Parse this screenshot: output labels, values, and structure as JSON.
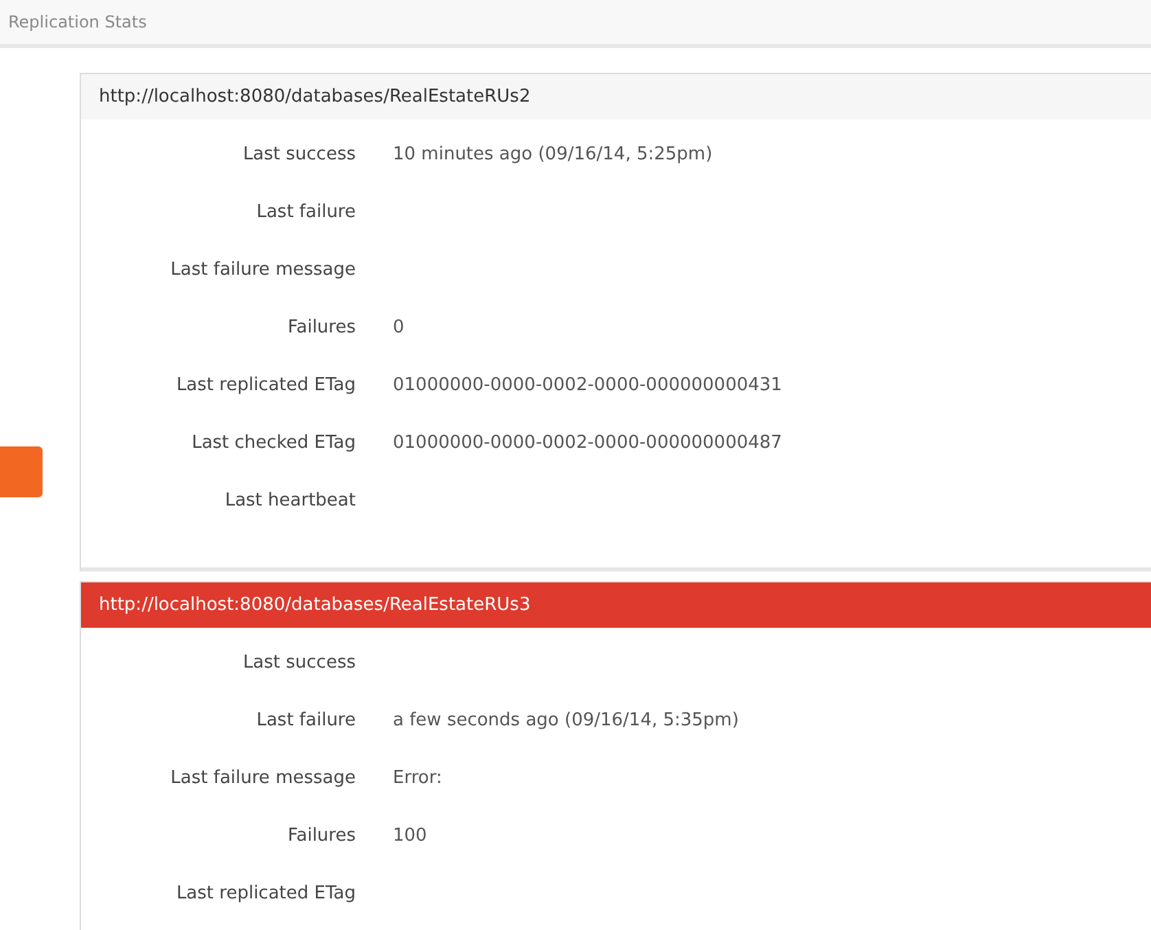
{
  "header": {
    "title": "Replication Stats"
  },
  "panels": [
    {
      "url": "http://localhost:8080/databases/RealEstateRUs2",
      "failed": false,
      "rows": [
        {
          "label": "Last success",
          "value": "10 minutes ago (09/16/14, 5:25pm)"
        },
        {
          "label": "Last failure"
        },
        {
          "label": "Last failure message"
        },
        {
          "label": "Failures",
          "value": "0"
        },
        {
          "label": "Last replicated ETag",
          "value": "01000000-0000-0002-0000-000000000431"
        },
        {
          "label": "Last checked ETag",
          "value": "01000000-0000-0002-0000-000000000487"
        },
        {
          "label": "Last heartbeat"
        }
      ]
    },
    {
      "url": "http://localhost:8080/databases/RealEstateRUs3",
      "failed": true,
      "rows": [
        {
          "label": "Last success"
        },
        {
          "label": "Last failure",
          "value": "a few seconds ago (09/16/14, 5:35pm)"
        },
        {
          "label": "Last failure message",
          "value": "Error:"
        },
        {
          "label": "Failures",
          "value": "100"
        },
        {
          "label": "Last replicated ETag"
        }
      ]
    }
  ]
}
